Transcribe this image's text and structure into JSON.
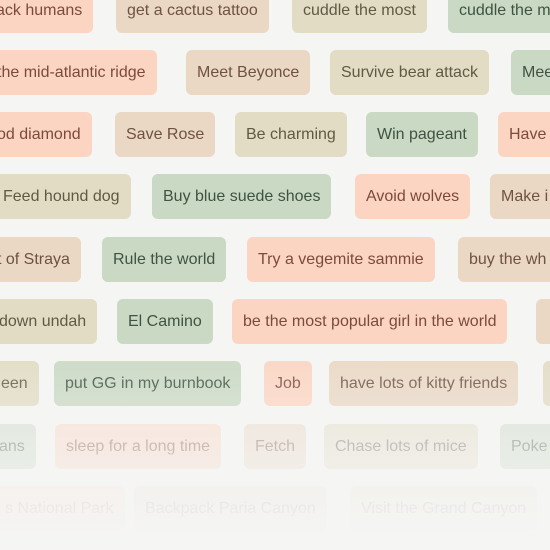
{
  "tags": [
    {
      "text": "ack humans",
      "color": "peach"
    },
    {
      "text": "get a cactus tattoo",
      "color": "tan"
    },
    {
      "text": "cuddle the most",
      "color": "khaki"
    },
    {
      "text": "cuddle the m",
      "color": "sage"
    },
    {
      "text": "the mid-atlantic ridge",
      "color": "peach"
    },
    {
      "text": "Meet Beyonce",
      "color": "tan"
    },
    {
      "text": "Survive bear attack",
      "color": "khaki"
    },
    {
      "text": "Mee",
      "color": "sage"
    },
    {
      "text": "od diamond",
      "color": "peach"
    },
    {
      "text": "Save Rose",
      "color": "tan"
    },
    {
      "text": "Be charming",
      "color": "khaki"
    },
    {
      "text": "Win pageant",
      "color": "sage"
    },
    {
      "text": "Have",
      "color": "peach"
    },
    {
      "text": "Feed hound dog",
      "color": "khaki"
    },
    {
      "text": "Buy blue suede shoes",
      "color": "sage"
    },
    {
      "text": "Avoid wolves",
      "color": "peach"
    },
    {
      "text": "Make i",
      "color": "tan"
    },
    {
      "text": "t of Straya",
      "color": "tan"
    },
    {
      "text": "Rule the world",
      "color": "sage"
    },
    {
      "text": "Try a vegemite sammie",
      "color": "peach"
    },
    {
      "text": "buy the wh",
      "color": "tan"
    },
    {
      "text": "down undah",
      "color": "khaki"
    },
    {
      "text": "El Camino",
      "color": "sage"
    },
    {
      "text": "be the most popular girl in the world",
      "color": "peach"
    },
    {
      "text": "",
      "color": "tan"
    },
    {
      "text": "een",
      "color": "khaki"
    },
    {
      "text": "put GG in my burnbook",
      "color": "sage"
    },
    {
      "text": "Job",
      "color": "peach"
    },
    {
      "text": "have lots of kitty friends",
      "color": "tan"
    },
    {
      "text": "",
      "color": "khaki"
    },
    {
      "text": "ans",
      "color": "sage"
    },
    {
      "text": "sleep for a long time",
      "color": "peach"
    },
    {
      "text": "Fetch",
      "color": "tan"
    },
    {
      "text": "Chase lots of mice",
      "color": "khaki"
    },
    {
      "text": "Poke",
      "color": "sage"
    },
    {
      "text": "s National Park",
      "color": "peach"
    },
    {
      "text": "Backpack Paria Canyon",
      "color": "tan"
    },
    {
      "text": "Visit the Grand Canyon",
      "color": "khaki"
    }
  ]
}
